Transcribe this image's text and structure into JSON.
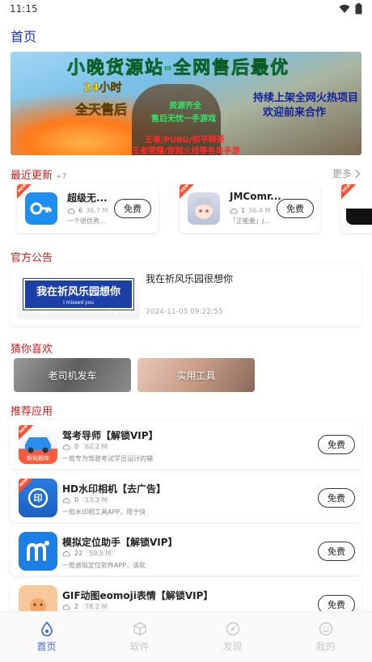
{
  "status": {
    "time": "11:15"
  },
  "header": {
    "title": "首页"
  },
  "banner": {
    "title": "小晚货源站-全网售后最优",
    "line_24h": "24小时",
    "line_all_day": "全天售后",
    "line_resources": "资源齐全",
    "line_after_sale": "售后无忧一手游戏",
    "line_project_1": "持续上架全网火热项目",
    "line_project_2": "欢迎前来合作",
    "line_red_1": "王者/PUBG/和平精英",
    "line_red_2": "王者荣耀/穿越火线等各类手游"
  },
  "recent": {
    "title": "最近更新",
    "count": "+7",
    "more": "更多",
    "items": [
      {
        "name": "超级无...",
        "downloads": "6",
        "size": "36.7 M",
        "desc": "一个很优秀...",
        "button": "免费",
        "new_tag": "NEW",
        "icon": "key-icon"
      },
      {
        "name": "JMComr...",
        "downloads": "1",
        "size": "36.4 M",
        "desc": "「正能量」J...",
        "button": "免费",
        "new_tag": "NEW",
        "icon": "anime-girl-icon"
      },
      {
        "name": "",
        "downloads": "",
        "size": "",
        "desc": "",
        "button": "",
        "new_tag": "NEW",
        "icon": "partial-app-icon"
      }
    ]
  },
  "notice": {
    "title": "官方公告",
    "sign_big": "我在祈风乐园想你",
    "sign_small": "I missed you",
    "sign_left": "◀ 西",
    "sign_right": "东 ▶",
    "text": "我在祈风乐园很想你",
    "time": "2024-11-05 09:22:55"
  },
  "like": {
    "title": "猜你喜欢",
    "tiles": [
      "老司机发车",
      "实用工具"
    ]
  },
  "recommend": {
    "title": "推荐应用",
    "items": [
      {
        "name": "驾考导师【解锁VIP】",
        "downloads": "0",
        "size": "62.2 M",
        "desc": "一款专为驾驶考试学员设计的辅",
        "button": "免费",
        "new_tag": "NEW",
        "icon_caption": "新规题库",
        "icon": "car-icon"
      },
      {
        "name": "HD水印相机【去广告】",
        "downloads": "0",
        "size": "13.3 M",
        "desc": "一款水印相工具APP，用于快",
        "button": "免费",
        "new_tag": "NEW",
        "icon_caption": "",
        "icon_letter": "印",
        "icon": "watermark-camera-icon"
      },
      {
        "name": "模拟定位助手【解锁VIP】",
        "downloads": "22",
        "size": "59.5 M",
        "desc": "一款虚拟定位软件APP，该软",
        "button": "免费",
        "new_tag": "",
        "icon_caption": "",
        "icon": "location-m-icon"
      },
      {
        "name": "GIF动图eomoji表情【解锁VIP】",
        "downloads": "2",
        "size": "78.2 M",
        "desc": "",
        "button": "免费",
        "new_tag": "",
        "icon_caption": "",
        "icon": "emoji-icon"
      }
    ]
  },
  "tabs": [
    {
      "label": "首页",
      "icon": "home-drop-icon",
      "active": true
    },
    {
      "label": "软件",
      "icon": "cube-icon",
      "active": false
    },
    {
      "label": "发现",
      "icon": "compass-icon",
      "active": false
    },
    {
      "label": "我的",
      "icon": "smile-icon",
      "active": false
    }
  ],
  "colors": {
    "accent": "#3566f1",
    "section_title": "#d31b1b",
    "page_title": "#1a2fcc"
  }
}
